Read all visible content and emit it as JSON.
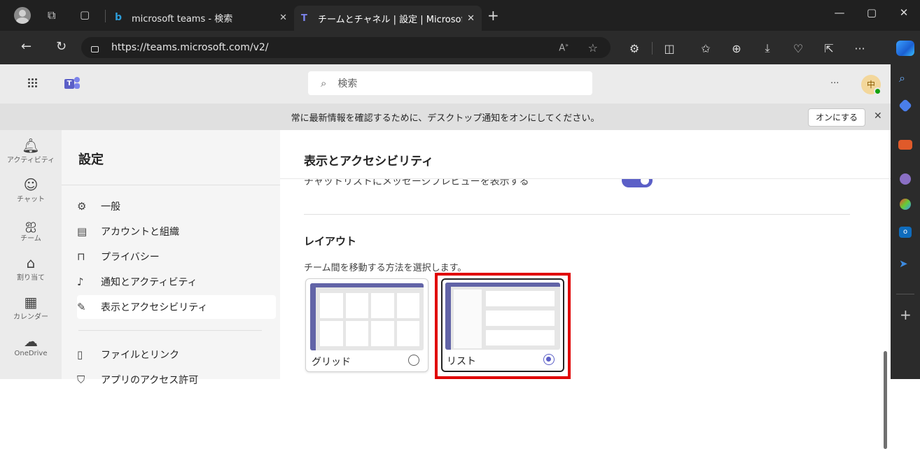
{
  "browser": {
    "tabs": [
      {
        "title": "microsoft teams - 検索"
      },
      {
        "title": "チームとチャネル | 設定 | Microsoft T"
      }
    ],
    "url": "https://teams.microsoft.com/v2/",
    "toolbar_icons": [
      "read-aloud-icon",
      "favorite-icon",
      "extensions-icon",
      "split-screen-icon",
      "favorites-list-icon",
      "collections-icon",
      "downloads-icon",
      "performance-icon",
      "share-icon",
      "more-icon"
    ]
  },
  "teams": {
    "search_placeholder": "検索",
    "more": "···",
    "avatar_initial": "中",
    "banner": {
      "text": "常に最新情報を確認するために、デスクトップ通知をオンにしてください。",
      "button": "オンにする",
      "close": "✕"
    },
    "rail": [
      {
        "label": "アクティビティ",
        "icon": "bell-icon"
      },
      {
        "label": "チャット",
        "icon": "chat-icon"
      },
      {
        "label": "チーム",
        "icon": "teams-icon"
      },
      {
        "label": "割り当て",
        "icon": "assignments-icon"
      },
      {
        "label": "カレンダー",
        "icon": "calendar-icon"
      },
      {
        "label": "OneDrive",
        "icon": "onedrive-icon"
      }
    ],
    "settings": {
      "title": "設定",
      "items": [
        {
          "label": "一般",
          "icon": "gear-icon"
        },
        {
          "label": "アカウントと組織",
          "icon": "id-card-icon"
        },
        {
          "label": "プライバシー",
          "icon": "lock-icon"
        },
        {
          "label": "通知とアクティビティ",
          "icon": "bell-icon"
        },
        {
          "label": "表示とアクセシビリティ",
          "icon": "wand-icon",
          "selected": true
        },
        {
          "label": "ファイルとリンク",
          "icon": "file-icon"
        },
        {
          "label": "アプリのアクセス許可",
          "icon": "shield-icon"
        }
      ]
    },
    "content": {
      "title": "表示とアクセシビリティ",
      "toggle_label": "チャットリストにメッセージプレビューを表示する",
      "toggle_on": true,
      "layout_heading": "レイアウト",
      "layout_desc": "チーム間を移動する方法を選択します。",
      "options": [
        {
          "label": "グリッド",
          "selected": false
        },
        {
          "label": "リスト",
          "selected": true
        }
      ]
    }
  },
  "colors": {
    "accent": "#5b5fc7",
    "highlight": "#e00000"
  }
}
